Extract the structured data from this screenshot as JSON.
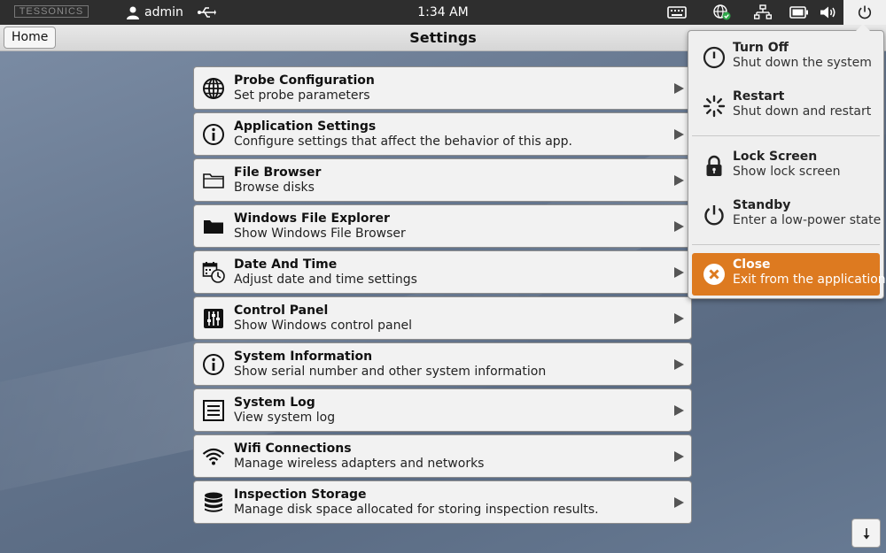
{
  "topbar": {
    "logo": "TESSONICS",
    "user": "admin",
    "clock": "1:34 AM"
  },
  "titlebar": {
    "home_label": "Home",
    "title": "Settings"
  },
  "settings": [
    {
      "title": "Probe Configuration",
      "subtitle": "Set probe parameters",
      "icon": "globe-icon"
    },
    {
      "title": "Application Settings",
      "subtitle": "Configure settings that affect the behavior of this app.",
      "icon": "info-icon"
    },
    {
      "title": "File Browser",
      "subtitle": "Browse disks",
      "icon": "folder-outline-icon"
    },
    {
      "title": "Windows File Explorer",
      "subtitle": "Show Windows File Browser",
      "icon": "folder-filled-icon"
    },
    {
      "title": "Date And Time",
      "subtitle": "Adjust date and time settings",
      "icon": "calendar-clock-icon"
    },
    {
      "title": "Control Panel",
      "subtitle": "Show Windows control panel",
      "icon": "sliders-icon"
    },
    {
      "title": "System Information",
      "subtitle": "Show serial number and other system information",
      "icon": "info-icon"
    },
    {
      "title": "System Log",
      "subtitle": "View system log",
      "icon": "list-icon"
    },
    {
      "title": "Wifi Connections",
      "subtitle": "Manage wireless adapters and networks",
      "icon": "wifi-icon"
    },
    {
      "title": "Inspection Storage",
      "subtitle": "Manage disk space allocated for storing inspection results.",
      "icon": "database-icon"
    }
  ],
  "power_menu": [
    {
      "title": "Turn Off",
      "subtitle": "Shut down the system",
      "icon": "power-icon"
    },
    {
      "title": "Restart",
      "subtitle": "Shut down and restart",
      "icon": "restart-spinner-icon"
    },
    {
      "title": "Lock Screen",
      "subtitle": "Show lock screen",
      "icon": "lock-icon"
    },
    {
      "title": "Standby",
      "subtitle": "Enter a low-power state",
      "icon": "standby-icon"
    },
    {
      "title": "Close",
      "subtitle": "Exit from the application",
      "icon": "close-circle-icon"
    }
  ],
  "colors": {
    "accent": "#dd7a20",
    "topbar": "#2e2e2e",
    "row_bg": "#f2f2f2"
  }
}
